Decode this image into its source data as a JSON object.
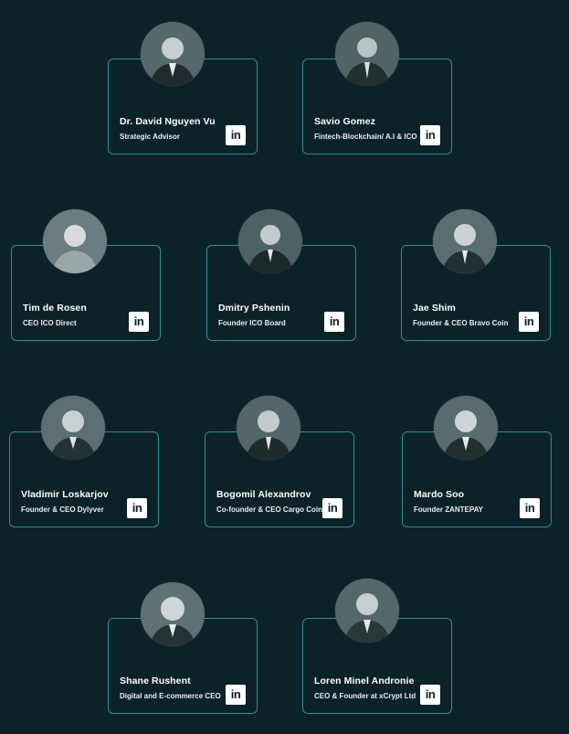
{
  "team": [
    {
      "name": "Dr. David Nguyen Vu",
      "role": "Strategic Advisor",
      "linkedin": "in"
    },
    {
      "name": "Savio Gomez",
      "role": "Fintech-Blockchain/ A.I & ICO",
      "linkedin": "in"
    },
    {
      "name": "Tim de Rosen",
      "role": "CEO ICO Direct",
      "linkedin": "in"
    },
    {
      "name": "Dmitry Pshenin",
      "role": "Founder ICO Board",
      "linkedin": "in"
    },
    {
      "name": "Jae Shim",
      "role": "Founder & CEO Bravo Coin",
      "linkedin": "in"
    },
    {
      "name": "Vladimir Loskarjov",
      "role": "Founder & CEO Dylyver",
      "linkedin": "in"
    },
    {
      "name": "Bogomil Alexandrov",
      "role": "Co-founder & CEO Cargo Coin",
      "linkedin": "in"
    },
    {
      "name": "Mardo Soo",
      "role": "Founder ZANTEPAY",
      "linkedin": "in"
    },
    {
      "name": "Shane Rushent",
      "role": "Digital and E-commerce CEO",
      "linkedin": "in"
    },
    {
      "name": "Loren Minel Andronie",
      "role": "CEO & Founder at xCrypt Ltd",
      "linkedin": "in"
    }
  ],
  "colors": {
    "background": "#0b2228",
    "card_border": "#2f8f92",
    "text": "#ffffff"
  },
  "icons": {
    "avatar": "person-photo-icon",
    "linkedin": "linkedin-icon"
  }
}
